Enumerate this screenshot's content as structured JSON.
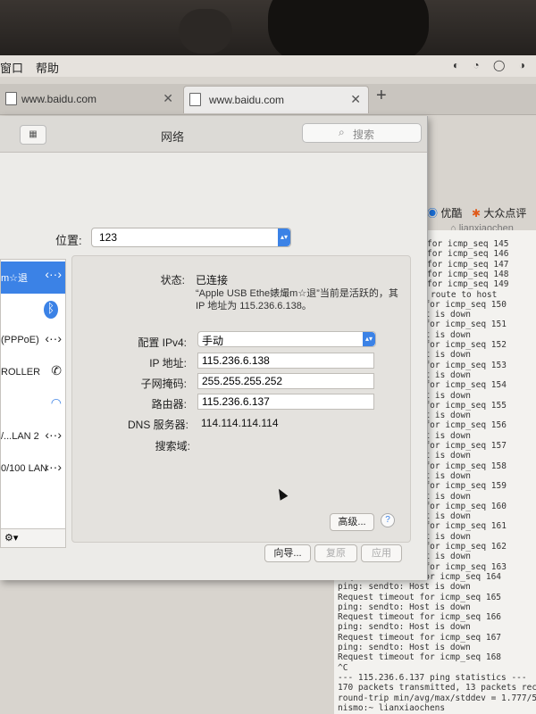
{
  "menubar": {
    "items": [
      "窗口",
      "帮助"
    ]
  },
  "tabs": [
    {
      "label": "www.baidu.com",
      "active": false
    },
    {
      "label": "www.baidu.com",
      "active": true
    }
  ],
  "bookmarks": {
    "youku": "优酷",
    "dazhong": "大众点评",
    "user": "lianxiaochen"
  },
  "window": {
    "title": "网络",
    "search_placeholder": "搜索",
    "location_label": "位置:",
    "location_value": "123",
    "sidebar": [
      {
        "label": "m☆退",
        "icon": "usb-ethernet-icon",
        "selected": true
      },
      {
        "label": "",
        "icon": "bluetooth-icon",
        "selected": false
      },
      {
        "label": "(PPPoE)",
        "icon": "pppoe-icon",
        "selected": false
      },
      {
        "label": "ROLLER",
        "icon": "controller-icon",
        "selected": false
      },
      {
        "label": "",
        "icon": "wifi-icon",
        "selected": false
      },
      {
        "label": "/...LAN 2",
        "icon": "lan2-icon",
        "selected": false
      },
      {
        "label": "0/100 LAN",
        "icon": "lan-icon",
        "selected": false
      }
    ],
    "status_label": "状态:",
    "status_value": "已连接",
    "status_desc_1": "“Apple USB Ethe婊熶m☆退”当前是活跃的，其",
    "status_desc_2": "IP 地址为 115.236.6.138。",
    "configure_label": "配置 IPv4:",
    "configure_value": "手动",
    "ip_label": "IP 地址:",
    "ip_value": "115.236.6.138",
    "subnet_label": "子网掩码:",
    "subnet_value": "255.255.255.252",
    "router_label": "路由器:",
    "router_value": "115.236.6.137",
    "dns_label": "DNS 服务器:",
    "dns_value": "114.114.114.114",
    "search_domain_label": "搜索域:",
    "advanced_button": "高级...",
    "help_button": "?",
    "assist_button": "向导...",
    "revert_button": "复原",
    "apply_button": "应用"
  },
  "terminal_lines": [
    "for icmp_seq 145",
    "for icmp_seq 146",
    "for icmp_seq 147",
    "for icmp_seq 148",
    "for icmp_seq 149",
    "route to host",
    "t for icmp_seq 150",
    "ost is down",
    "t for icmp_seq 151",
    "ost is down",
    "t for icmp_seq 152",
    "ost is down",
    "t for icmp_seq 153",
    "ost is down",
    "t for icmp_seq 154",
    "ost is down",
    "t for icmp_seq 155",
    "ost is down",
    "t for icmp_seq 156",
    "ost is down",
    "t for icmp_seq 157",
    "ost is down",
    "t for icmp_seq 158",
    "ost is down",
    "t for icmp_seq 159",
    "ost is down",
    "t for icmp_seq 160",
    "ost is down",
    "t for icmp_seq 161",
    "ost is down",
    "t for icmp_seq 162",
    "ost is down",
    "t for icmp_seq 163",
    "Request timeout for icmp_seq 164",
    "ping: sendto: Host is down",
    "Request timeout for icmp_seq 165",
    "ping: sendto: Host is down",
    "Request timeout for icmp_seq 166",
    "ping: sendto: Host is down",
    "Request timeout for icmp_seq 167",
    "ping: sendto: Host is down",
    "Request timeout for icmp_seq 168",
    "^C",
    "--- 115.236.6.137 ping statistics ---",
    "170 packets transmitted, 13 packets received,",
    "round-trip min/avg/max/stddev = 1.777/53.376/",
    "nismo:~ lianxiaochens"
  ]
}
